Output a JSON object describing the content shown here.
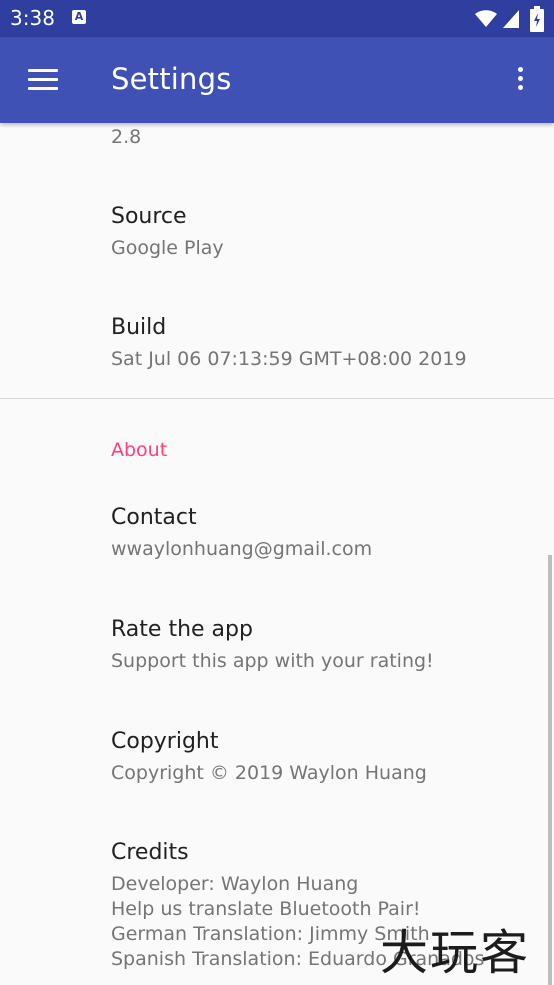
{
  "status_bar": {
    "time": "3:38",
    "notification_icon": "A"
  },
  "app_bar": {
    "title": "Settings"
  },
  "partial_item": {
    "summary": "2.8"
  },
  "source": {
    "title": "Source",
    "summary": "Google Play"
  },
  "build": {
    "title": "Build",
    "summary": "Sat Jul 06 07:13:59 GMT+08:00 2019"
  },
  "about_category": "About",
  "contact": {
    "title": "Contact",
    "summary": "wwaylonhuang@gmail.com"
  },
  "rate": {
    "title": "Rate the app",
    "summary": "Support this app with your rating!"
  },
  "copyright": {
    "title": "Copyright",
    "summary": "Copyright © 2019 Waylon Huang"
  },
  "credits": {
    "title": "Credits",
    "lines": [
      "Developer: Waylon Huang",
      "Help us translate Bluetooth Pair!",
      "German Translation: Jimmy Smith",
      "Spanish Translation: Eduardo Granados"
    ]
  },
  "watermark": "大玩客",
  "colors": {
    "status_bar": "#303f9f",
    "app_bar": "#3f51b5",
    "accent": "#ff4081",
    "background": "#fafafa"
  }
}
